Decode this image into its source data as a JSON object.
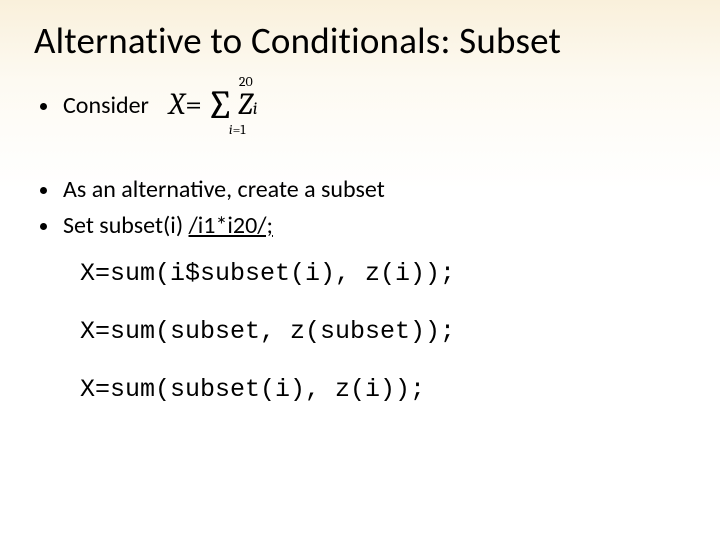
{
  "title": "Alternative to Conditionals: Subset",
  "bullets": {
    "consider": "Consider",
    "alt": "As an alternative, create a subset",
    "set_prefix": "Set subset(i) ",
    "set_underlined": "/i1*i20/;"
  },
  "formula": {
    "lhs": "X",
    "eq": " = ",
    "upper": "20",
    "lower_i": "i",
    "lower_eq": "=1",
    "rhs_Z": "Z",
    "rhs_sub": "i"
  },
  "code": {
    "line1": "X=sum(i$subset(i), z(i));",
    "line2": "X=sum(subset, z(subset));",
    "line3": "X=sum(subset(i), z(i));"
  }
}
